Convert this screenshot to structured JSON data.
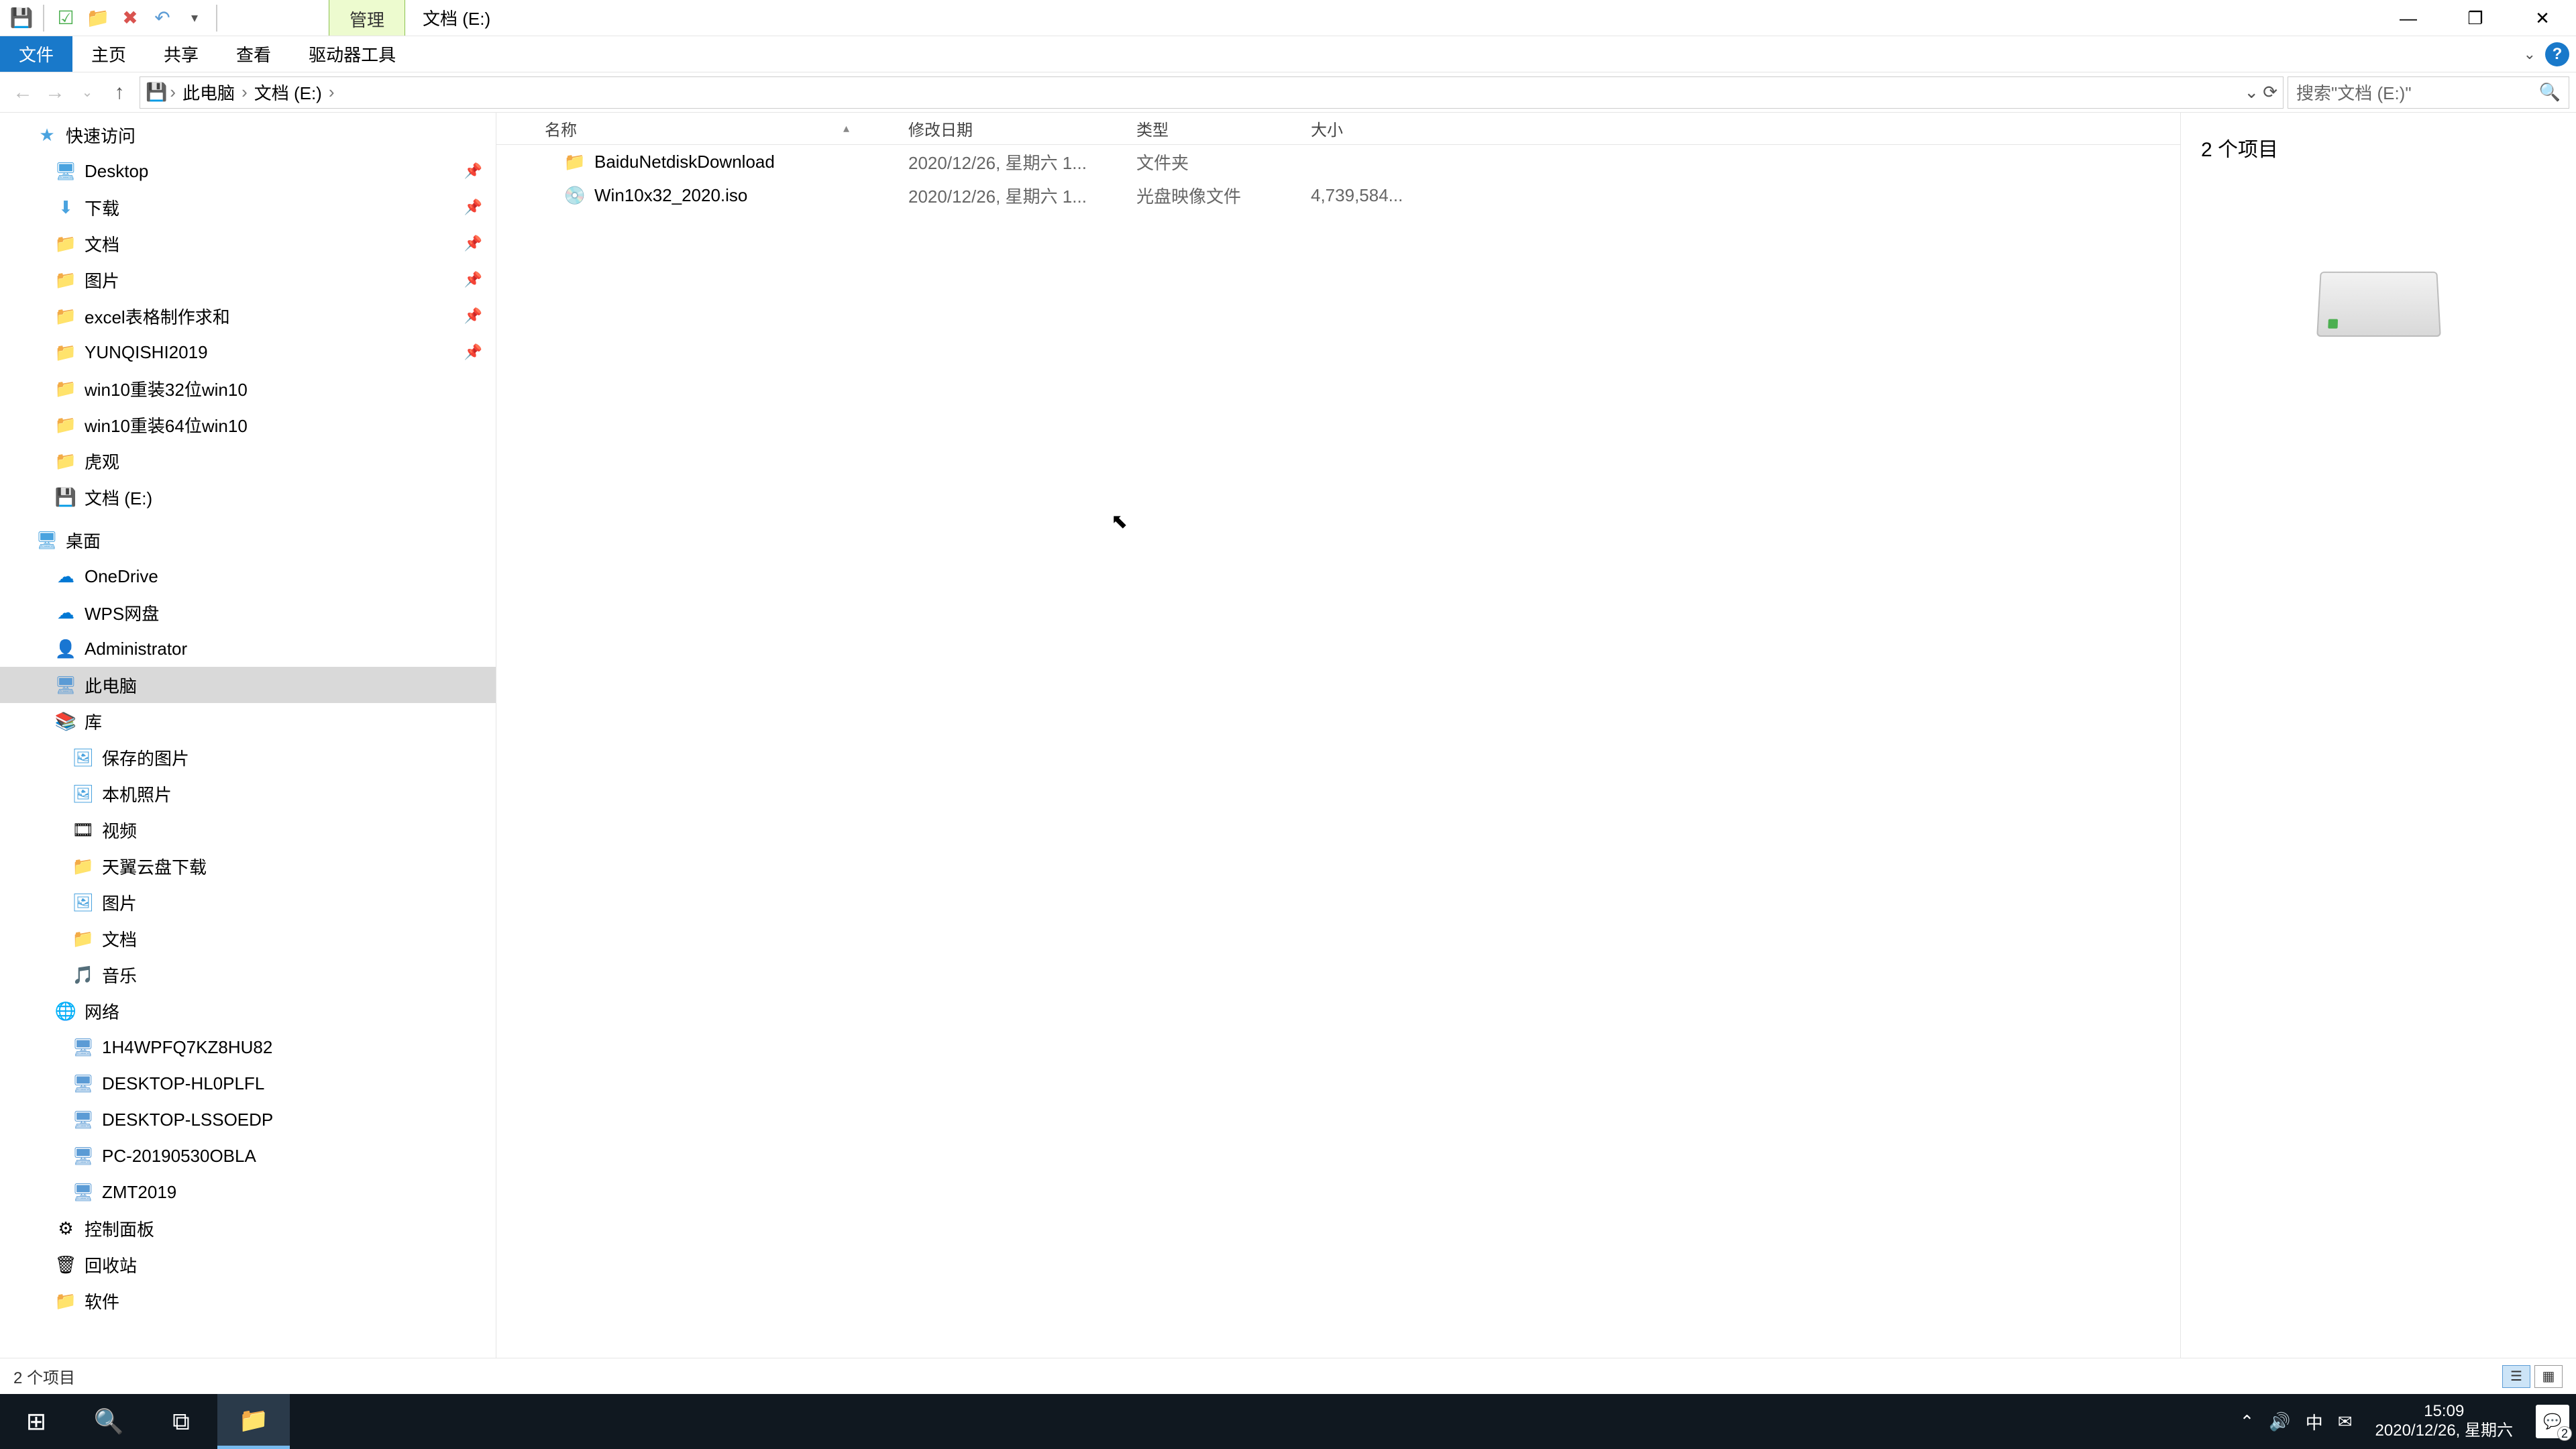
{
  "title_context_tab": "管理",
  "window_title": "文档 (E:)",
  "ribbon": {
    "file": "文件",
    "home": "主页",
    "share": "共享",
    "view": "查看",
    "drive_tools": "驱动器工具"
  },
  "breadcrumb": {
    "pc": "此电脑",
    "drive": "文档 (E:)"
  },
  "search_placeholder": "搜索\"文档 (E:)\"",
  "columns": {
    "name": "名称",
    "date": "修改日期",
    "type": "类型",
    "size": "大小"
  },
  "files": [
    {
      "icon": "folder",
      "name": "BaiduNetdiskDownload",
      "date": "2020/12/26, 星期六 1...",
      "type": "文件夹",
      "size": ""
    },
    {
      "icon": "disc",
      "name": "Win10x32_2020.iso",
      "date": "2020/12/26, 星期六 1...",
      "type": "光盘映像文件",
      "size": "4,739,584..."
    }
  ],
  "preview_count": "2 个项目",
  "statusbar_text": "2 个项目",
  "tree": {
    "quick": "快速访问",
    "desktop": "Desktop",
    "downloads": "下载",
    "documents": "文档",
    "pictures": "图片",
    "excel": "excel表格制作求和",
    "yunqi": "YUNQISHI2019",
    "win32": "win10重装32位win10",
    "win64": "win10重装64位win10",
    "huguan": "虎观",
    "drive_e": "文档 (E:)",
    "zm": "桌面",
    "onedrive": "OneDrive",
    "wps": "WPS网盘",
    "admin": "Administrator",
    "thispc": "此电脑",
    "lib": "库",
    "saved_pics": "保存的图片",
    "local_photos": "本机照片",
    "videos": "视频",
    "tianyi": "天翼云盘下载",
    "pics2": "图片",
    "docs2": "文档",
    "music": "音乐",
    "network": "网络",
    "pc1": "1H4WPFQ7KZ8HU82",
    "pc2": "DESKTOP-HL0PLFL",
    "pc3": "DESKTOP-LSSOEDP",
    "pc4": "PC-20190530OBLA",
    "pc5": "ZMT2019",
    "ctrlpanel": "控制面板",
    "recycle": "回收站",
    "soft": "软件"
  },
  "tray": {
    "ime": "中",
    "time": "15:09",
    "date": "2020/12/26, 星期六",
    "notif_count": "2"
  }
}
